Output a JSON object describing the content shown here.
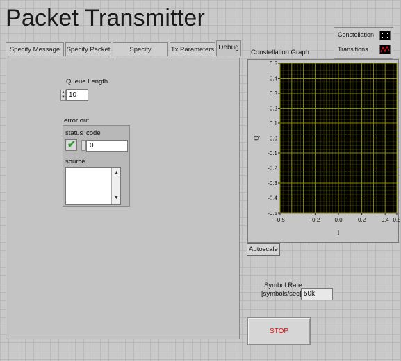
{
  "window": {
    "title": "Packet Transmitter"
  },
  "tabs": [
    {
      "label": "Specify Message",
      "active": false
    },
    {
      "label": "Specify Packet",
      "active": false
    },
    {
      "label": "Specify Modulation",
      "active": false
    },
    {
      "label": "Tx Parameters",
      "active": false
    },
    {
      "label": "Debug",
      "active": true
    }
  ],
  "debug": {
    "queue_length_label": "Queue Length",
    "queue_length_value": "10",
    "error_out": {
      "label": "error out",
      "status_label": "status",
      "code_label": "code",
      "code_value": "0",
      "source_label": "source",
      "status_ok": true
    }
  },
  "graph": {
    "caption": "Constellation Graph",
    "legend": [
      {
        "label": "Constellation",
        "icon": "constellation-icon"
      },
      {
        "label": "Transitions",
        "icon": "transitions-icon"
      }
    ],
    "autoscale_label": "Autoscale"
  },
  "chart_data": {
    "type": "scatter",
    "title": "Constellation Graph",
    "xlabel": "I",
    "ylabel": "Q",
    "xlim": [
      -0.5,
      0.5
    ],
    "ylim": [
      -0.5,
      0.5
    ],
    "x_ticks": [
      "-0.5",
      "-0.2",
      "0.0",
      "0.2",
      "0.4",
      "0.5"
    ],
    "y_ticks": [
      "0.5",
      "0.4",
      "0.3",
      "0.2",
      "0.1",
      "0.0",
      "-0.1",
      "-0.2",
      "-0.3",
      "-0.4",
      "-0.5"
    ],
    "series": [],
    "grid": true,
    "grid_color": "#8a8a00",
    "plot_background": "#000000"
  },
  "symbol_rate": {
    "label_line1": "Symbol Rate",
    "label_line2": "[symbols/sec]",
    "value": "50k"
  },
  "stop_button": {
    "label": "STOP",
    "color": "#e01010"
  }
}
